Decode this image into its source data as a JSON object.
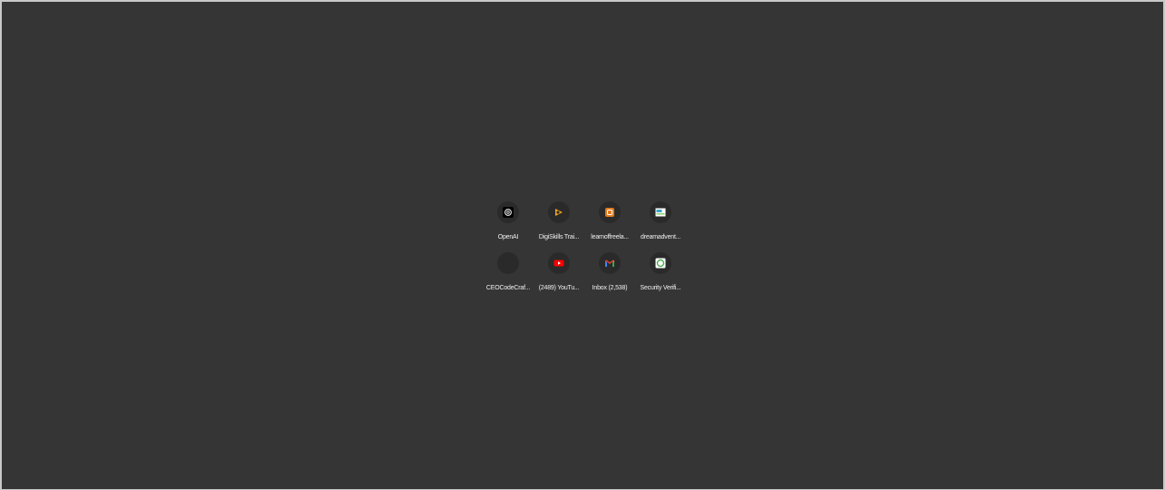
{
  "shortcuts": [
    {
      "label": "OpenAI",
      "icon": "openai-icon"
    },
    {
      "label": "DigiSkills Trai...",
      "icon": "digiskills-icon"
    },
    {
      "label": "learnoffreela...",
      "icon": "learnoffreelancing-icon"
    },
    {
      "label": "dreamadvent...",
      "icon": "dreamadventure-icon"
    },
    {
      "label": "CEOCodeCraf...",
      "icon": "ceocodecraft-icon"
    },
    {
      "label": "(2489) YouTu...",
      "icon": "youtube-icon"
    },
    {
      "label": "Inbox (2,538)",
      "icon": "gmail-icon"
    },
    {
      "label": "Security Verifi...",
      "icon": "security-verification-icon"
    }
  ],
  "colors": {
    "background": "#353535",
    "tile_circle": "#2a2a2a",
    "label_text": "#f0f0f0"
  }
}
